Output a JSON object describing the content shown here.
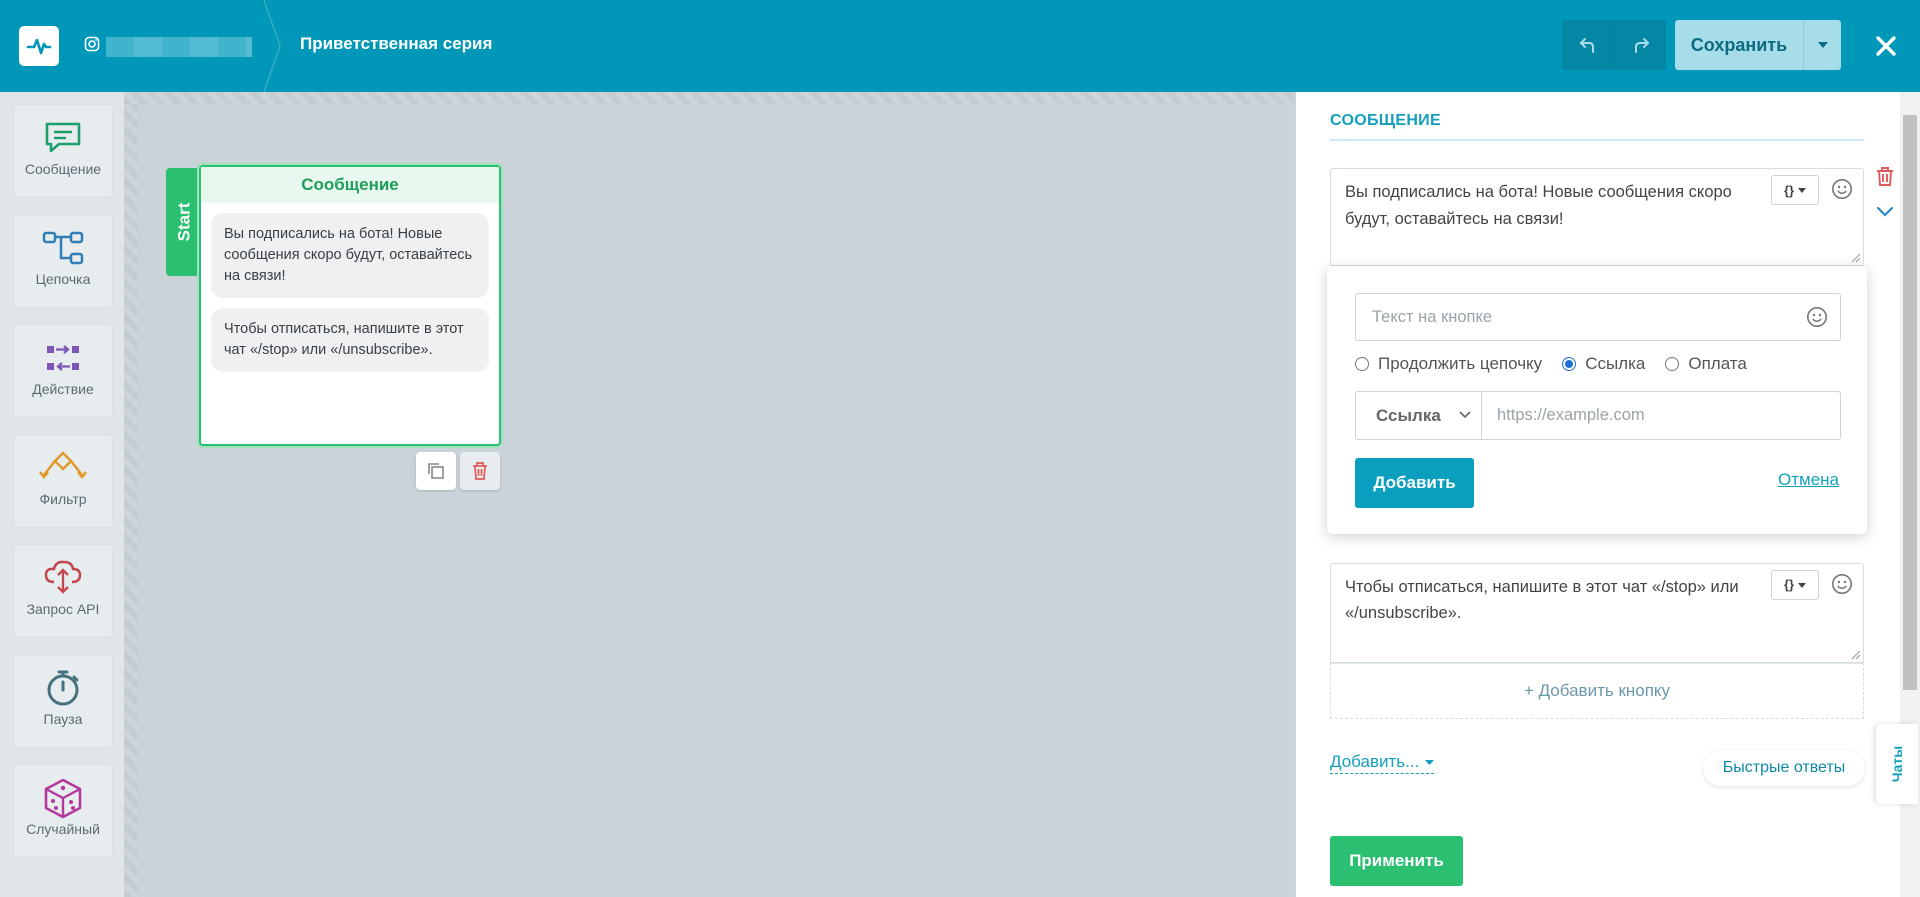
{
  "header": {
    "title": "Приветственная серия",
    "save_label": "Сохранить"
  },
  "toolbox": {
    "items": [
      {
        "label": "Сообщение",
        "icon": "message-icon"
      },
      {
        "label": "Цепочка",
        "icon": "chain-icon"
      },
      {
        "label": "Действие",
        "icon": "action-icon"
      },
      {
        "label": "Фильтр",
        "icon": "filter-icon"
      },
      {
        "label": "Запрос API",
        "icon": "api-request-icon"
      },
      {
        "label": "Пауза",
        "icon": "pause-timer-icon"
      },
      {
        "label": "Случайный",
        "icon": "random-dice-icon"
      }
    ]
  },
  "canvas": {
    "start_label": "Start",
    "node": {
      "title": "Сообщение",
      "bubbles": [
        "Вы подписались на бота! Новые сообщения скоро будут, оставайтесь на связи!",
        "Чтобы отписаться, напишите в этот чат «/stop» или «/unsubscribe»."
      ]
    }
  },
  "panel": {
    "title": "СООБЩЕНИЕ",
    "message1": "Вы подписались на бота! Новые сообщения скоро будут, оставайтесь на связи!",
    "var_label": "{}",
    "button_popup": {
      "text_placeholder": "Текст на кнопке",
      "radios": [
        {
          "label": "Продолжить цепочку",
          "checked": false
        },
        {
          "label": "Ссылка",
          "checked": true
        },
        {
          "label": "Оплата",
          "checked": false
        }
      ],
      "link_type": "Ссылка",
      "url_placeholder": "https://example.com",
      "add_label": "Добавить",
      "cancel_label": "Отмена"
    },
    "message2": "Чтобы отписаться, напишите в этот чат «/stop» или «/unsubscribe».",
    "add_button_label": "+ Добавить кнопку",
    "add_more_label": "Добавить...",
    "quick_replies_label": "Быстрые ответы",
    "apply_label": "Применить",
    "chats_tab": "Чаты"
  },
  "colors": {
    "header": "#0097b9",
    "accent": "#14a0bd",
    "success": "#2bbf72",
    "danger": "#e05a5a"
  }
}
